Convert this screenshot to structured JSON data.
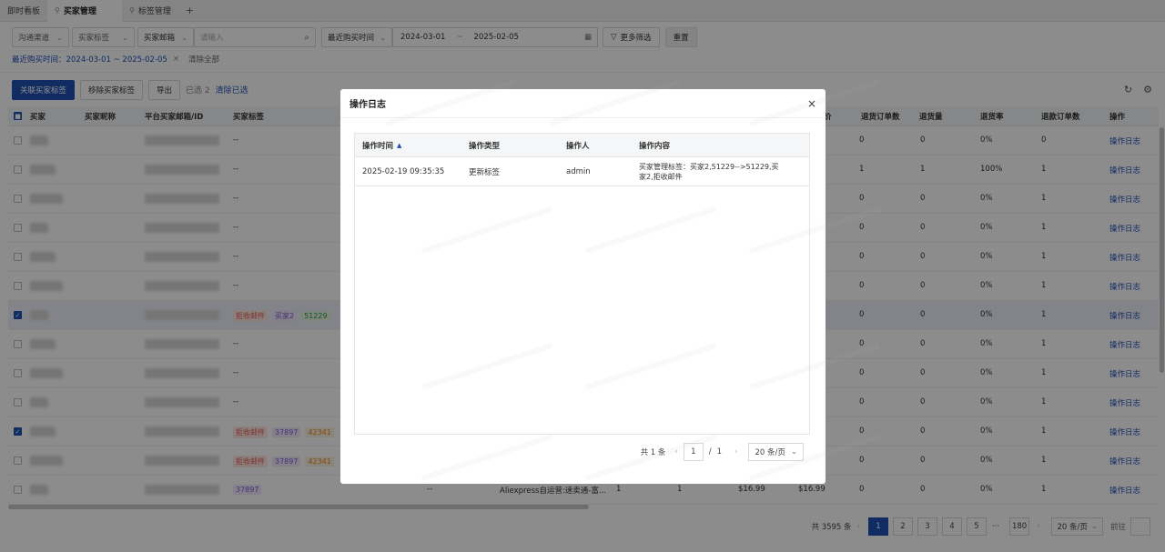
{
  "tabs": [
    {
      "label": "即时看板",
      "active": false
    },
    {
      "label": "买家管理",
      "active": true
    },
    {
      "label": "标签管理",
      "active": false
    }
  ],
  "tab_add": "+",
  "filters": {
    "channel": "沟通渠道",
    "buyer_tag": "买家标签",
    "buyer_email": "买家邮箱",
    "search_placeholder": "请输入",
    "last_buy_time": "最近购买时间",
    "date_start": "2024-03-01",
    "date_sep": "~",
    "date_end": "2025-02-05",
    "more_filter": "更多筛选",
    "reset": "重置"
  },
  "active_chip": "最近购买时间：2024-03-01 ~ 2025-02-05",
  "clear_all": "清除全部",
  "toolbar": {
    "link_tag": "关联买家标签",
    "remove_tag": "移除买家标签",
    "export": "导出",
    "selected": "已选 2",
    "clear_selected": "清除已选"
  },
  "table": {
    "headers": {
      "buyer": "买家",
      "nickname": "买家昵称",
      "email": "平台买家邮箱/ID",
      "tags": "买家标签",
      "price": "价",
      "return_orders": "退货订单数",
      "return_qty": "退货量",
      "return_rate": "退货率",
      "refund_orders": "退款订单数",
      "action": "操作"
    },
    "rows": [
      {
        "checked": false,
        "tags": [],
        "tag_text": "--",
        "return_orders": "0",
        "return_qty": "0",
        "return_rate": "0%",
        "refund_orders": "0",
        "action": "操作日志"
      },
      {
        "checked": false,
        "tags": [],
        "tag_text": "--",
        "return_orders": "1",
        "return_qty": "1",
        "return_rate": "100%",
        "refund_orders": "1",
        "action": "操作日志"
      },
      {
        "checked": false,
        "tags": [],
        "tag_text": "--",
        "return_orders": "0",
        "return_qty": "0",
        "return_rate": "0%",
        "refund_orders": "1",
        "action": "操作日志"
      },
      {
        "checked": false,
        "tags": [],
        "tag_text": "--",
        "return_orders": "0",
        "return_qty": "0",
        "return_rate": "0%",
        "refund_orders": "1",
        "action": "操作日志"
      },
      {
        "checked": false,
        "tags": [],
        "tag_text": "--",
        "return_orders": "0",
        "return_qty": "0",
        "return_rate": "0%",
        "refund_orders": "1",
        "action": "操作日志"
      },
      {
        "checked": false,
        "tags": [],
        "tag_text": "--",
        "return_orders": "0",
        "return_qty": "0",
        "return_rate": "0%",
        "refund_orders": "1",
        "action": "操作日志"
      },
      {
        "checked": true,
        "tags": [
          {
            "t": "拒收邮件",
            "c": "red"
          },
          {
            "t": "买家2",
            "c": "purple"
          },
          {
            "t": "51229",
            "c": "green"
          }
        ],
        "tag_text": "",
        "return_orders": "0",
        "return_qty": "0",
        "return_rate": "0%",
        "refund_orders": "1",
        "action": "操作日志"
      },
      {
        "checked": false,
        "tags": [],
        "tag_text": "--",
        "return_orders": "0",
        "return_qty": "0",
        "return_rate": "0%",
        "refund_orders": "1",
        "action": "操作日志"
      },
      {
        "checked": false,
        "tags": [],
        "tag_text": "--",
        "return_orders": "0",
        "return_qty": "0",
        "return_rate": "0%",
        "refund_orders": "1",
        "action": "操作日志"
      },
      {
        "checked": false,
        "tags": [],
        "tag_text": "--",
        "return_orders": "0",
        "return_qty": "0",
        "return_rate": "0%",
        "refund_orders": "1",
        "action": "操作日志"
      },
      {
        "checked": true,
        "tags": [
          {
            "t": "拒收邮件",
            "c": "red"
          },
          {
            "t": "37897",
            "c": "purple"
          },
          {
            "t": "42341",
            "c": "orange"
          }
        ],
        "tag_text": "",
        "return_orders": "0",
        "return_qty": "0",
        "return_rate": "0%",
        "refund_orders": "1",
        "action": "操作日志"
      },
      {
        "checked": false,
        "tags": [
          {
            "t": "拒收邮件",
            "c": "red"
          },
          {
            "t": "37897",
            "c": "purple"
          },
          {
            "t": "42341",
            "c": "orange"
          }
        ],
        "tag_text": "",
        "return_orders": "0",
        "return_qty": "0",
        "return_rate": "0%",
        "refund_orders": "1",
        "action": "操作日志"
      },
      {
        "checked": false,
        "tags": [
          {
            "t": "37897",
            "c": "purple"
          }
        ],
        "tag_text": "",
        "extra": {
          "dash": "--",
          "store": "Aliexpress自运营:速卖通-富...",
          "c1": "1",
          "c2": "1",
          "p1": "$16.99",
          "p2": "$16.99"
        },
        "return_orders": "0",
        "return_qty": "0",
        "return_rate": "0%",
        "refund_orders": "1",
        "action": "操作日志"
      }
    ]
  },
  "pager": {
    "total": "共 3595 条",
    "pages": [
      "1",
      "2",
      "3",
      "4",
      "5"
    ],
    "ellipsis": "···",
    "last": "180",
    "size": "20 条/页",
    "goto": "前往"
  },
  "modal": {
    "title": "操作日志",
    "close": "×",
    "headers": {
      "time": "操作时间",
      "type": "操作类型",
      "operator": "操作人",
      "content": "操作内容"
    },
    "rows": [
      {
        "time": "2025-02-19 09:35:35",
        "type": "更新标签",
        "operator": "admin",
        "content": "买家管理标签：买家2,51229-->51229,买家2,拒收邮件"
      }
    ],
    "pager": {
      "total": "共 1 条",
      "page": "1",
      "slash": "/",
      "pages": "1",
      "size": "20 条/页"
    }
  },
  "colors": {
    "primary": "#1e50b3"
  }
}
